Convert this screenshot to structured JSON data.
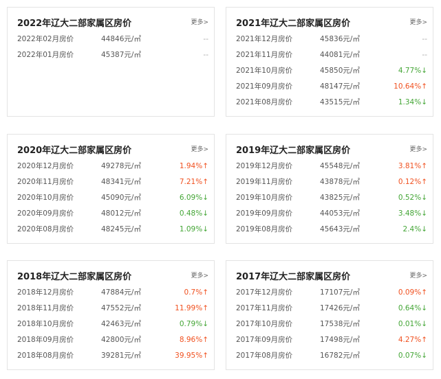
{
  "more_label": "更多>",
  "colors": {
    "up": "#f0501f",
    "down": "#43a535",
    "neutral": "#aaaaaa"
  },
  "cards": [
    {
      "title": "2022年辽大二部家属区房价",
      "rows": [
        {
          "month": "2022年02月房价",
          "price": "44846元/㎡",
          "change": "--",
          "trend": "none"
        },
        {
          "month": "2022年01月房价",
          "price": "45387元/㎡",
          "change": "--",
          "trend": "none"
        }
      ]
    },
    {
      "title": "2021年辽大二部家属区房价",
      "rows": [
        {
          "month": "2021年12月房价",
          "price": "45836元/㎡",
          "change": "--",
          "trend": "none"
        },
        {
          "month": "2021年11月房价",
          "price": "44081元/㎡",
          "change": "--",
          "trend": "none"
        },
        {
          "month": "2021年10月房价",
          "price": "45850元/㎡",
          "change": "4.77%↓",
          "trend": "down"
        },
        {
          "month": "2021年09月房价",
          "price": "48147元/㎡",
          "change": "10.64%↑",
          "trend": "up"
        },
        {
          "month": "2021年08月房价",
          "price": "43515元/㎡",
          "change": "1.34%↓",
          "trend": "down"
        }
      ]
    },
    {
      "title": "2020年辽大二部家属区房价",
      "rows": [
        {
          "month": "2020年12月房价",
          "price": "49278元/㎡",
          "change": "1.94%↑",
          "trend": "up"
        },
        {
          "month": "2020年11月房价",
          "price": "48341元/㎡",
          "change": "7.21%↑",
          "trend": "up"
        },
        {
          "month": "2020年10月房价",
          "price": "45090元/㎡",
          "change": "6.09%↓",
          "trend": "down"
        },
        {
          "month": "2020年09月房价",
          "price": "48012元/㎡",
          "change": "0.48%↓",
          "trend": "down"
        },
        {
          "month": "2020年08月房价",
          "price": "48245元/㎡",
          "change": "1.09%↓",
          "trend": "down"
        }
      ]
    },
    {
      "title": "2019年辽大二部家属区房价",
      "rows": [
        {
          "month": "2019年12月房价",
          "price": "45548元/㎡",
          "change": "3.81%↑",
          "trend": "up"
        },
        {
          "month": "2019年11月房价",
          "price": "43878元/㎡",
          "change": "0.12%↑",
          "trend": "up"
        },
        {
          "month": "2019年10月房价",
          "price": "43825元/㎡",
          "change": "0.52%↓",
          "trend": "down"
        },
        {
          "month": "2019年09月房价",
          "price": "44053元/㎡",
          "change": "3.48%↓",
          "trend": "down"
        },
        {
          "month": "2019年08月房价",
          "price": "45643元/㎡",
          "change": "2.4%↓",
          "trend": "down"
        }
      ]
    },
    {
      "title": "2018年辽大二部家属区房价",
      "rows": [
        {
          "month": "2018年12月房价",
          "price": "47884元/㎡",
          "change": "0.7%↑",
          "trend": "up"
        },
        {
          "month": "2018年11月房价",
          "price": "47552元/㎡",
          "change": "11.99%↑",
          "trend": "up"
        },
        {
          "month": "2018年10月房价",
          "price": "42463元/㎡",
          "change": "0.79%↓",
          "trend": "down"
        },
        {
          "month": "2018年09月房价",
          "price": "42800元/㎡",
          "change": "8.96%↑",
          "trend": "up"
        },
        {
          "month": "2018年08月房价",
          "price": "39281元/㎡",
          "change": "39.95%↑",
          "trend": "up"
        }
      ]
    },
    {
      "title": "2017年辽大二部家属区房价",
      "rows": [
        {
          "month": "2017年12月房价",
          "price": "17107元/㎡",
          "change": "0.09%↑",
          "trend": "up"
        },
        {
          "month": "2017年11月房价",
          "price": "17426元/㎡",
          "change": "0.64%↓",
          "trend": "down"
        },
        {
          "month": "2017年10月房价",
          "price": "17538元/㎡",
          "change": "0.01%↓",
          "trend": "down"
        },
        {
          "month": "2017年09月房价",
          "price": "17498元/㎡",
          "change": "4.27%↑",
          "trend": "up"
        },
        {
          "month": "2017年08月房价",
          "price": "16782元/㎡",
          "change": "0.07%↓",
          "trend": "down"
        }
      ]
    }
  ]
}
